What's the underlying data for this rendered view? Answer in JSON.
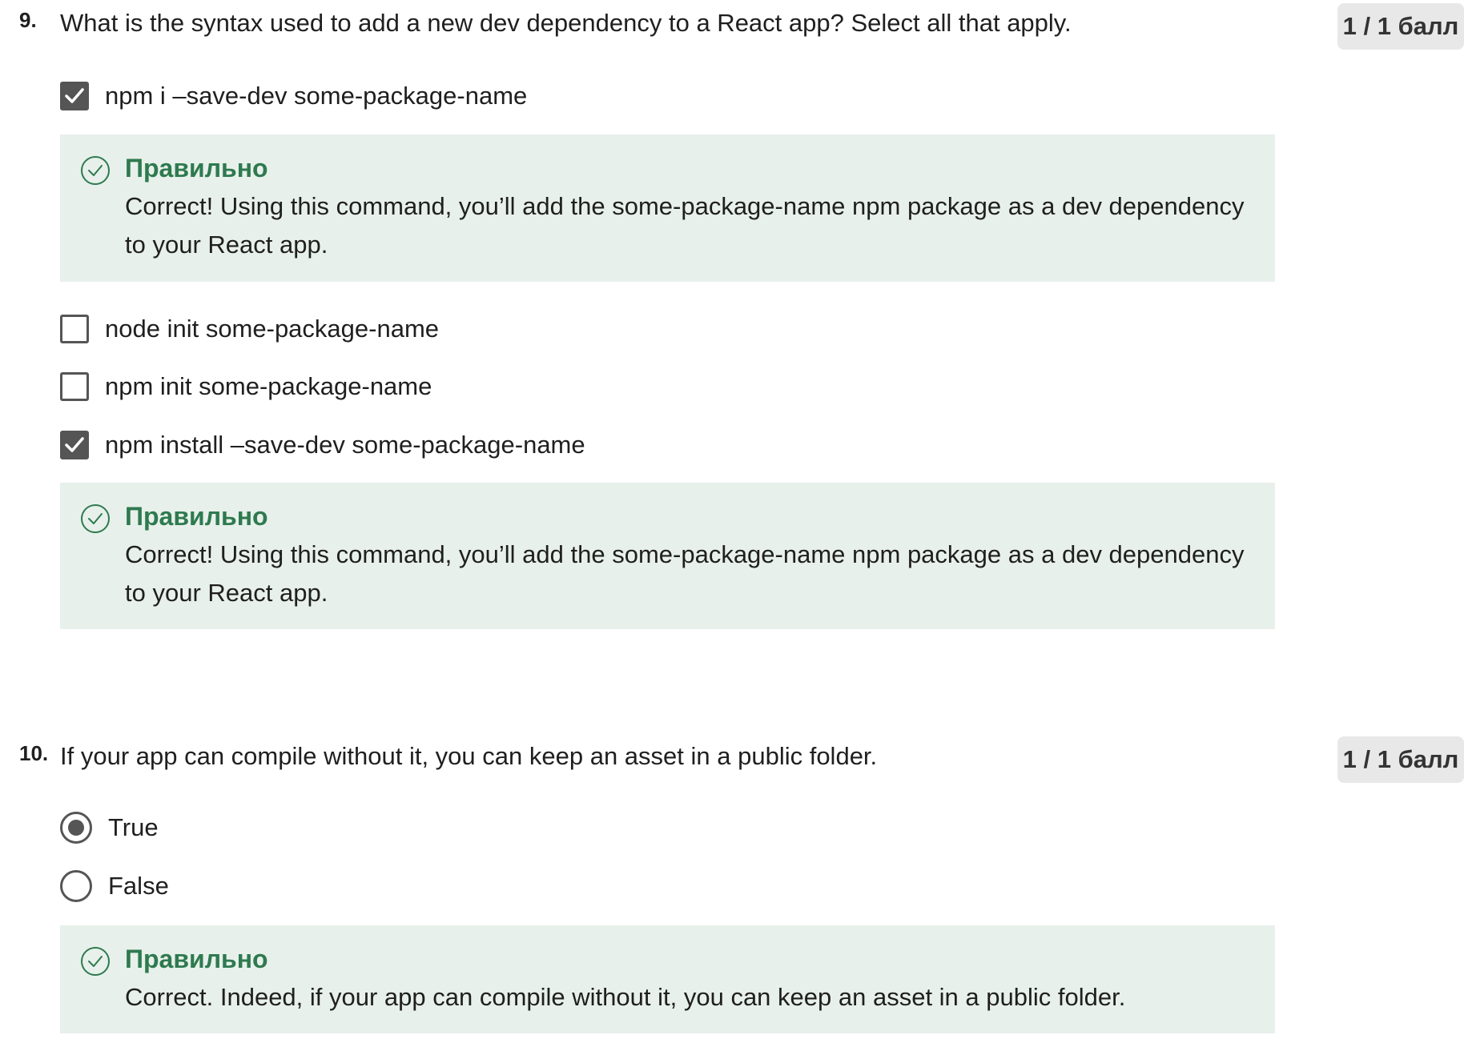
{
  "questions": [
    {
      "number": "9.",
      "text": "What is the syntax used to add a new dev dependency to a React app? Select all that apply.",
      "score": "1 / 1 балл",
      "options": [
        {
          "label": "npm i –save-dev some-package-name",
          "checked": true
        },
        {
          "label": "node init some-package-name",
          "checked": false
        },
        {
          "label": "npm init some-package-name",
          "checked": false
        },
        {
          "label": "npm install –save-dev some-package-name",
          "checked": true
        }
      ],
      "feedback": [
        {
          "title": "Правильно",
          "text": "Correct! Using this command, you’ll add the some-package-name npm package as a dev dependency to your React app."
        },
        {
          "title": "Правильно",
          "text": "Correct! Using this command, you’ll add the some-package-name npm package as a dev dependency to your React app."
        }
      ]
    },
    {
      "number": "10.",
      "text": "If your app can compile without it, you can keep an asset in a public folder.",
      "score": "1 / 1 балл",
      "options": [
        {
          "label": "True",
          "selected": true
        },
        {
          "label": "False",
          "selected": false
        }
      ],
      "feedback": [
        {
          "title": "Правильно",
          "text": "Correct. Indeed, if your app can compile without it, you can keep an asset in a public folder."
        }
      ]
    }
  ],
  "colors": {
    "feedback_bg": "#e8f0eb",
    "correct_green": "#2e7a4f",
    "control_gray": "#555555",
    "badge_bg": "#e8e8e8"
  },
  "icons": {
    "correct": "check-circle-icon",
    "checkbox_checked": "checkmark-icon"
  }
}
